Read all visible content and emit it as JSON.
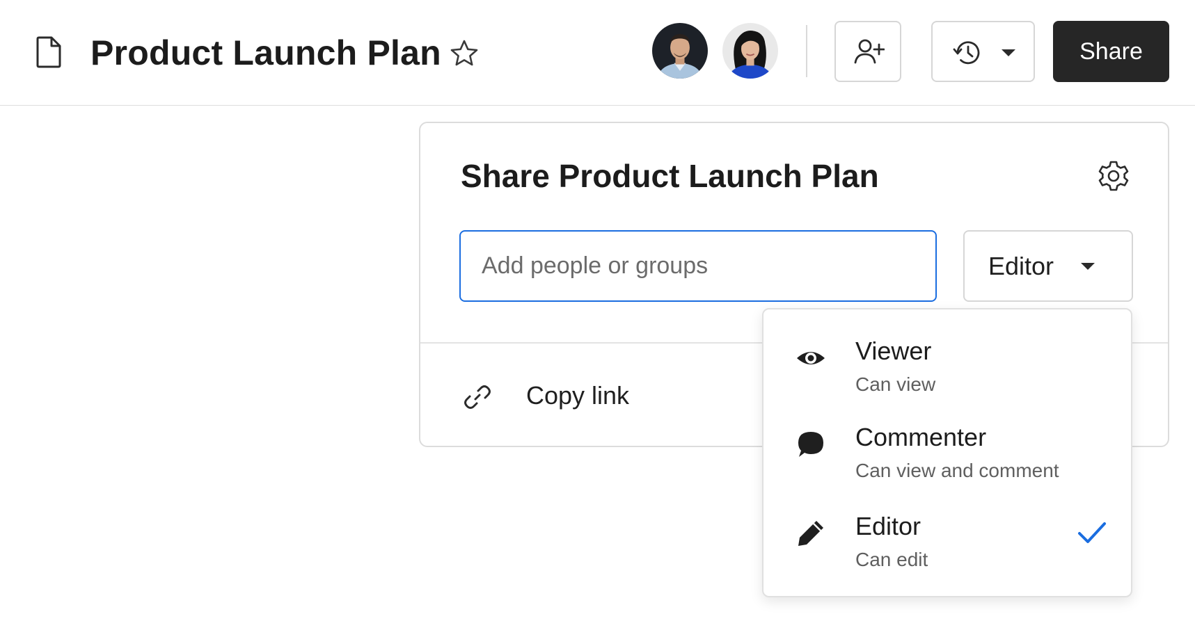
{
  "header": {
    "doc_title": "Product Launch Plan",
    "share_label": "Share"
  },
  "icons": {
    "doc": "file-icon",
    "star": "star-icon",
    "add_user": "add-user-icon",
    "history": "history-icon",
    "settings": "gear-icon",
    "link": "link-icon",
    "viewer": "eye-icon",
    "commenter": "comment-icon",
    "editor": "pencil-icon",
    "selected": "check-icon"
  },
  "share_panel": {
    "title": "Share Product Launch Plan",
    "input_placeholder": "Add people or groups",
    "role_selected": "Editor",
    "copy_link_label": "Copy link"
  },
  "role_menu": {
    "items": [
      {
        "label": "Viewer",
        "description": "Can view",
        "selected": false
      },
      {
        "label": "Commenter",
        "description": "Can view and comment",
        "selected": false
      },
      {
        "label": "Editor",
        "description": "Can edit",
        "selected": true
      }
    ]
  },
  "colors": {
    "accent": "#1a6de0",
    "share_button_bg": "#262626"
  }
}
